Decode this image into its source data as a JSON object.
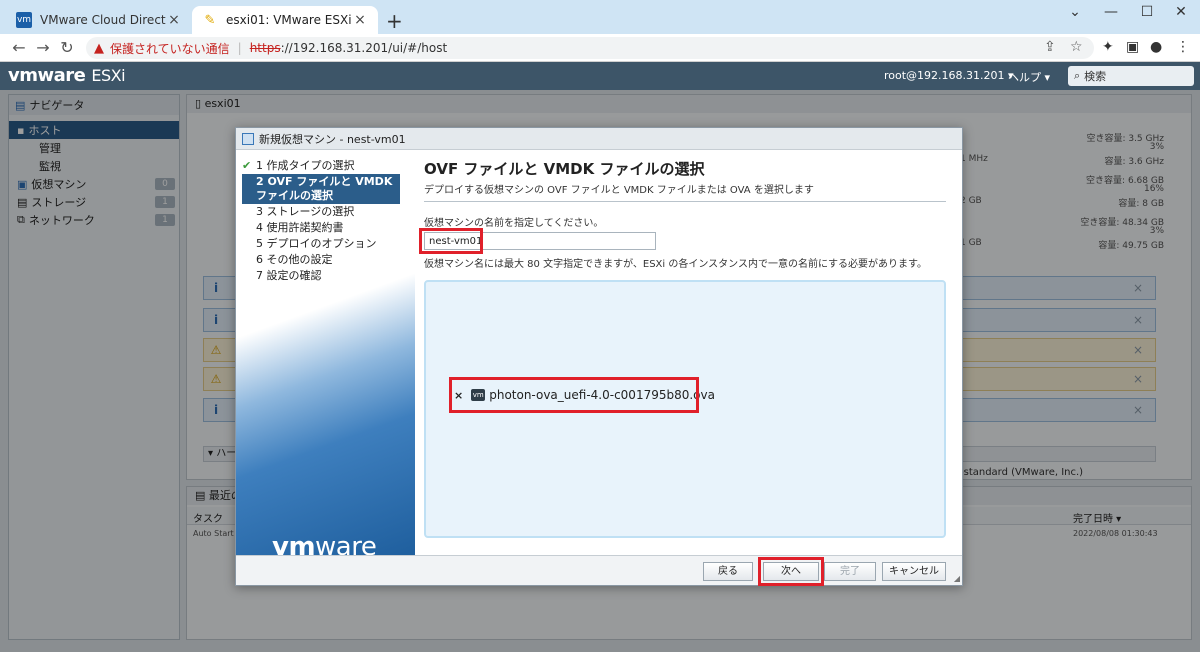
{
  "browser": {
    "tabs": [
      {
        "title": "VMware Cloud Director - vApp -",
        "icon": "vmware-icon"
      },
      {
        "title": "esxi01: VMware ESXi",
        "icon": "pencil-icon"
      }
    ],
    "new_tab": "+",
    "url_warning": "保護されていない通信",
    "url_scheme": "https",
    "url_rest": "://192.168.31.201/ui/#/host"
  },
  "esxi": {
    "logo_vm": "vmware",
    "logo_esxi": "ESXi",
    "user": "root@192.168.31.201 ▾",
    "help": "ヘルプ ▾",
    "search_placeholder": "検索"
  },
  "navigator": {
    "title": "ナビゲータ",
    "items": [
      {
        "label": "ホスト",
        "selected": true
      },
      {
        "label": "管理"
      },
      {
        "label": "監視"
      },
      {
        "label": "仮想マシン",
        "count": "0"
      },
      {
        "label": "ストレージ",
        "count": "1"
      },
      {
        "label": "ネットワーク",
        "count": "1"
      }
    ]
  },
  "host": {
    "title": "esxi01",
    "cpu_free": "空き容量: 3.5 GHz",
    "cpu_pct": "3%",
    "cpu_cap": "容量: 3.6 GHz",
    "cpu_used": "1 MHz",
    "mem_free": "空き容量: 6.68 GB",
    "mem_pct": "16%",
    "mem_cap": "容量: 8 GB",
    "mem_used": "2 GB",
    "sto_free": "空き容量: 48.34 GB",
    "sto_pct": "3%",
    "sto_cap": "容量: 49.75 GB",
    "sto_used": "1 GB",
    "hw_header": "▾ ハー",
    "hw_row": "-standard (VMware, Inc.)"
  },
  "tasks": {
    "title": "最近の",
    "col_task": "タスク",
    "col_done": "完了日時 ▾",
    "row_task": "Auto Start P",
    "row_time": "2022/08/08 01:30:43"
  },
  "wizard": {
    "title": "新規仮想マシン - nest-vm01",
    "steps": [
      {
        "label": "1 作成タイプの選択",
        "state": "done"
      },
      {
        "label": "2 OVF ファイルと VMDK ファイルの選択",
        "state": "active"
      },
      {
        "label": "3 ストレージの選択",
        "state": "todo"
      },
      {
        "label": "4 使用許諾契約書",
        "state": "todo"
      },
      {
        "label": "5 デプロイのオプション",
        "state": "todo"
      },
      {
        "label": "6 その他の設定",
        "state": "todo"
      },
      {
        "label": "7 設定の確認",
        "state": "todo"
      }
    ],
    "brand_vm": "vm",
    "brand_ware": "ware",
    "heading": "OVF ファイルと VMDK ファイルの選択",
    "description": "デプロイする仮想マシンの OVF ファイルと VMDK ファイルまたは OVA を選択します",
    "name_label": "仮想マシンの名前を指定してください。",
    "name_value": "nest-vm01",
    "name_hint": "仮想マシン名には最大 80 文字指定できますが、ESXi の各インスタンス内で一意の名前にする必要があります。",
    "file_remove": "×",
    "file_badge": "vm",
    "file_name": "photon-ova_uefi-4.0-c001795b80.ova",
    "buttons": {
      "back": "戻る",
      "next": "次へ",
      "finish": "完了",
      "cancel": "キャンセル"
    }
  },
  "colors": {
    "header_bg": "#3d5568",
    "selected_blue": "#2b5d8a",
    "highlight_red": "#e0202a"
  }
}
